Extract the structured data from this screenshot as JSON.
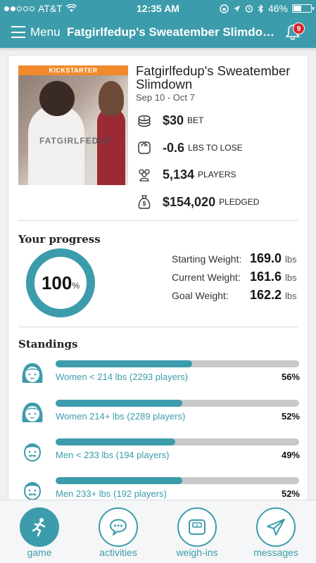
{
  "status_bar": {
    "carrier": "AT&T",
    "time": "12:35 AM",
    "battery": "46%",
    "battery_level": 0.46
  },
  "nav": {
    "menu_label": "Menu",
    "title": "Fatgirlfedup's Sweatember Slimdown",
    "notification_count": "9"
  },
  "game": {
    "image_badge": "KICKSTARTER",
    "image_watermark": "FATGIRLFEDUP",
    "title": "Fatgirlfedup's Sweatember Slimdown",
    "dates": "Sep 10 - Oct 7",
    "stats": [
      {
        "icon": "coins-icon",
        "value": "$30",
        "unit": "bet"
      },
      {
        "icon": "scale-icon",
        "value": "-0.6",
        "unit": "lbs to lose"
      },
      {
        "icon": "players-icon",
        "value": "5,134",
        "unit": "players"
      },
      {
        "icon": "money-bag-icon",
        "value": "$154,020",
        "unit": "pledged"
      }
    ]
  },
  "progress": {
    "title": "Your progress",
    "percent": "100",
    "percent_sign": "%",
    "percent_fraction": 1.0,
    "weights": [
      {
        "label": "Starting Weight:",
        "value": "169.0",
        "unit": "lbs"
      },
      {
        "label": "Current Weight:",
        "value": "161.6",
        "unit": "lbs"
      },
      {
        "label": "Goal Weight:",
        "value": "162.2",
        "unit": "lbs"
      }
    ]
  },
  "standings": {
    "title": "Standings",
    "rows": [
      {
        "icon": "woman-icon",
        "label": "Women < 214 lbs (2293 players)",
        "percent": "56%",
        "fill": 0.56
      },
      {
        "icon": "woman-icon",
        "label": "Women 214+ lbs (2289 players)",
        "percent": "52%",
        "fill": 0.52
      },
      {
        "icon": "man-icon",
        "label": "Men < 233 lbs (194 players)",
        "percent": "49%",
        "fill": 0.49
      },
      {
        "icon": "man-icon",
        "label": "Men 233+ lbs (192 players)",
        "percent": "52%",
        "fill": 0.52
      }
    ]
  },
  "tabs": [
    {
      "label": "game",
      "icon": "runner-icon",
      "active": true
    },
    {
      "label": "activities",
      "icon": "chat-bubble-icon",
      "active": false
    },
    {
      "label": "weigh-ins",
      "icon": "scale-icon",
      "active": false
    },
    {
      "label": "messages",
      "icon": "paper-plane-icon",
      "active": false
    }
  ],
  "colors": {
    "primary": "#3c9cab",
    "badge": "#d9262b",
    "kickstarter": "#f08a2c",
    "track": "#c7c9ca"
  }
}
